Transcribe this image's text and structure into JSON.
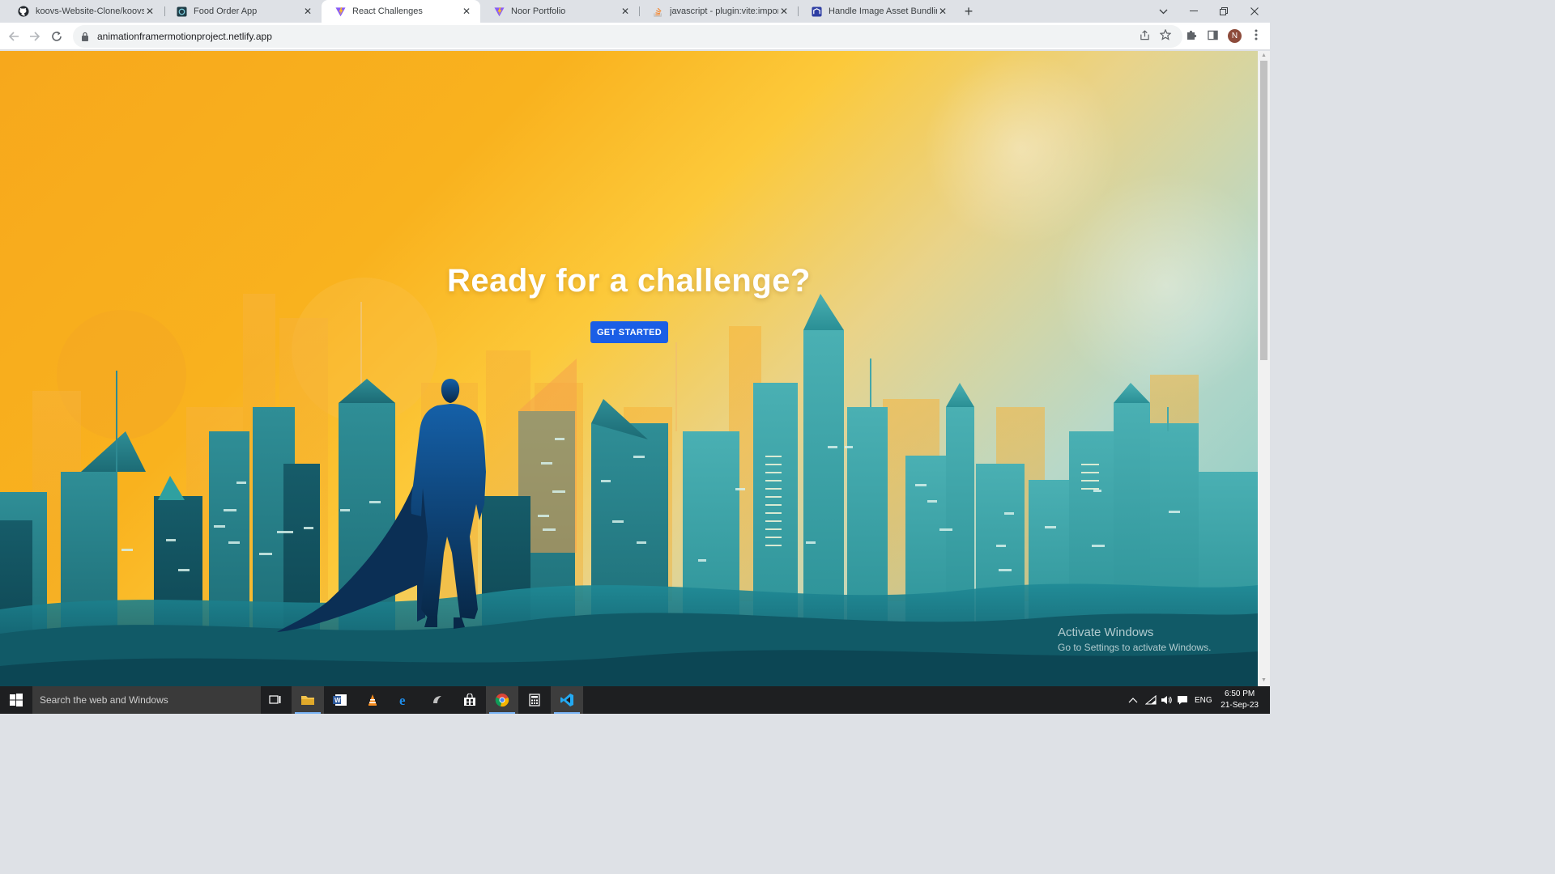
{
  "browser": {
    "tabs": [
      {
        "title": "koovs-Website-Clone/koovs.com",
        "favicon": "github-icon"
      },
      {
        "title": "Food Order App",
        "favicon": "app-icon"
      },
      {
        "title": "React Challenges",
        "favicon": "vite-icon",
        "active": true
      },
      {
        "title": "Noor Portfolio",
        "favicon": "vite-icon"
      },
      {
        "title": "javascript - plugin:vite:import-an",
        "favicon": "stackoverflow-icon"
      },
      {
        "title": "Handle Image Asset Bundling us",
        "favicon": "site-icon"
      }
    ],
    "url": "animationframermotionproject.netlify.app",
    "profile_initial": "N"
  },
  "page": {
    "headline": "Ready for a challenge?",
    "cta_label": "GET STARTED",
    "cta_color": "#1a5ee6"
  },
  "watermark": {
    "line1": "Activate Windows",
    "line2": "Go to Settings to activate Windows."
  },
  "taskbar": {
    "search_placeholder": "Search the web and Windows",
    "apps": [
      "task-view-icon",
      "file-explorer-icon",
      "word-icon",
      "vlc-icon",
      "edge-icon",
      "app-icon",
      "store-icon",
      "chrome-icon",
      "calculator-icon",
      "vscode-icon"
    ],
    "language": "ENG",
    "time": "6:50 PM",
    "date": "21-Sep-23"
  }
}
